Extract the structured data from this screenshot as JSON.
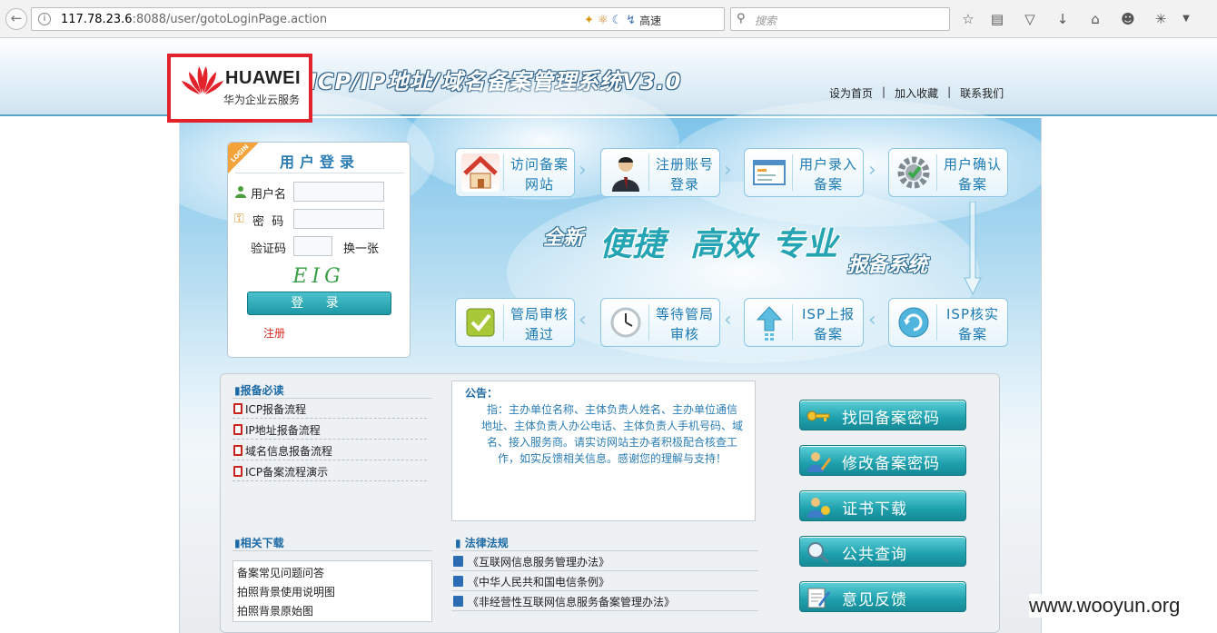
{
  "browser": {
    "url_host": "117.78.23.6",
    "url_rest": ":8088/user/gotoLoginPage.action",
    "speed_label": "高速",
    "search_placeholder": "搜索"
  },
  "header": {
    "logo_word": "HUAWEI",
    "logo_sub": "华为企业云服务",
    "title": "ICP/IP地址/域名备案管理系统V3.0",
    "links": [
      "设为首页",
      "加入收藏",
      "联系我们"
    ],
    "link_sep": "|"
  },
  "login": {
    "ribbon": "LOGIN",
    "title": "用户登录",
    "username_label": "用户名",
    "password_label": "密  码",
    "captcha_label": "验证码",
    "captcha_refresh": "换一张",
    "captcha_text": "EIG",
    "submit": "登 录",
    "register": "注册"
  },
  "steps": {
    "row1": [
      {
        "label1": "访问备案",
        "label2": "网站"
      },
      {
        "label1": "注册账号",
        "label2": "登录"
      },
      {
        "label1": "用户录入",
        "label2": "备案"
      },
      {
        "label1": "用户确认",
        "label2": "备案"
      }
    ],
    "row2": [
      {
        "label1": "管局审核",
        "label2": "通过"
      },
      {
        "label1": "等待管局",
        "label2": "审核"
      },
      {
        "label1": "ISP上报",
        "label2": "备案"
      },
      {
        "label1": "ISP核实",
        "label2": "备案"
      }
    ]
  },
  "slogan": {
    "new": "全新",
    "w1": "便捷",
    "w2": "高效",
    "w3": "专业",
    "system": "报备系统"
  },
  "required": {
    "title": "报备必读",
    "items": [
      "ICP报备流程",
      "IP地址报备流程",
      "域名信息报备流程",
      "ICP备案流程演示"
    ]
  },
  "notice": {
    "title": "公告：",
    "body": "指：主办单位名称、主体负责人姓名、主办单位通信 地址、主体负责人办公电话、主体负责人手机号码、域名、接入服务商。请实访网站主办者积极配合核查工作，如实反馈相关信息。感谢您的理解与支持！"
  },
  "downloads": {
    "title": "相关下载",
    "items": [
      "备案常见问题问答",
      "拍照背景使用说明图",
      "拍照背景原始图"
    ]
  },
  "laws": {
    "title": "法律法规",
    "items": [
      "《互联网信息服务管理办法》",
      "《中华人民共和国电信条例》",
      "《非经营性互联网信息服务备案管理办法》"
    ]
  },
  "actions": [
    "找回备案密码",
    "修改备案密码",
    "证书下载",
    "公共查询",
    "意见反馈"
  ],
  "watermark": "www.wooyun.org",
  "colors": {
    "accent": "#1ea0ad",
    "logo_red": "#e3232c",
    "link_blue": "#1b7ab3"
  }
}
